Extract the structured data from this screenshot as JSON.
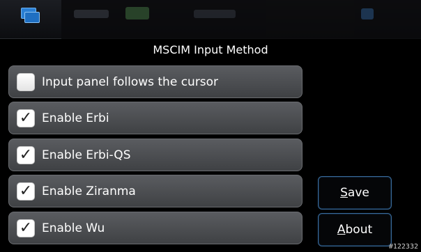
{
  "dialog": {
    "title": "MSCIM Input Method"
  },
  "options": [
    {
      "label": "Input panel follows the cursor",
      "checked": false
    },
    {
      "label": "Enable Erbi",
      "checked": true
    },
    {
      "label": "Enable Erbi-QS",
      "checked": true
    },
    {
      "label": "Enable Ziranma",
      "checked": true
    },
    {
      "label": "Enable Wu",
      "checked": true
    }
  ],
  "buttons": {
    "save": {
      "mnemonic": "S",
      "rest": "ave"
    },
    "about": {
      "mnemonic": "A",
      "rest": "bout"
    }
  },
  "checkmark_glyph": "✓",
  "watermark": "#122332",
  "colors": {
    "accent": "#3a6a9a",
    "app_icon": "#2a7fd4"
  }
}
